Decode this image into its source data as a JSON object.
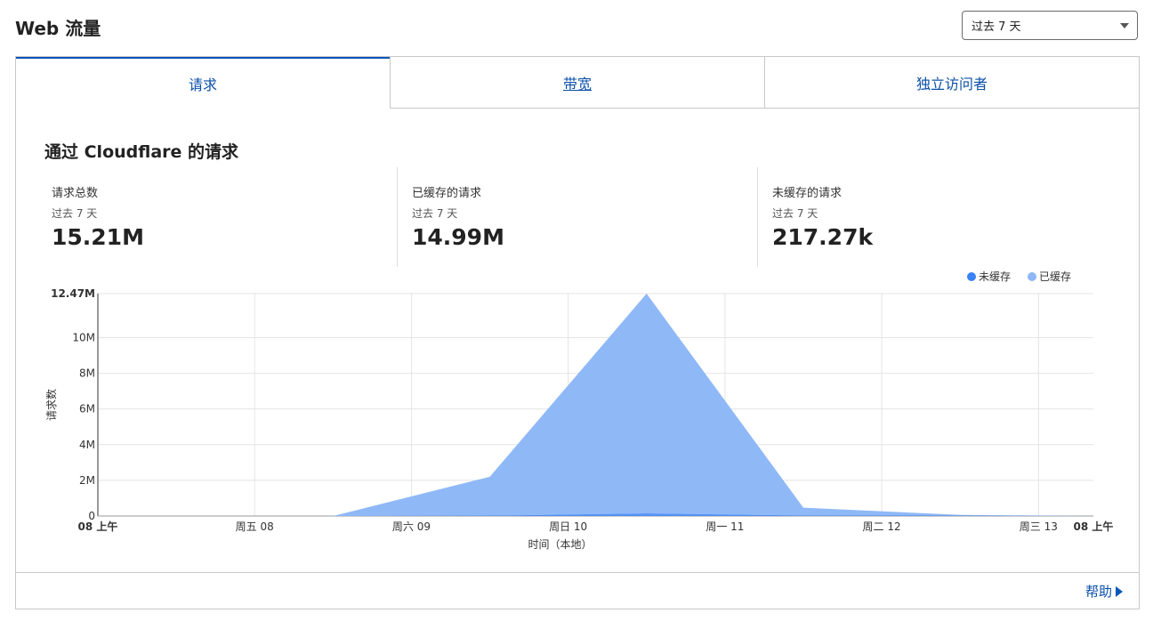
{
  "header": {
    "title": "Web 流量",
    "range_value": "过去 7 天"
  },
  "tabs": [
    {
      "label": "请求"
    },
    {
      "label": "带宽"
    },
    {
      "label": "独立访问者"
    }
  ],
  "section": {
    "title": "通过 Cloudflare 的请求"
  },
  "stats": [
    {
      "label": "请求总数",
      "period": "过去 7 天",
      "value": "15.21M"
    },
    {
      "label": "已缓存的请求",
      "period": "过去 7 天",
      "value": "14.99M"
    },
    {
      "label": "未缓存的请求",
      "period": "过去 7 天",
      "value": "217.27k"
    }
  ],
  "help": {
    "label": "帮助"
  },
  "colors": {
    "uncached": "#3b82f6",
    "cached": "#8fb8f7",
    "accent": "#0b4fa8"
  },
  "chart_data": {
    "type": "area",
    "stacked": true,
    "ylabel": "请求数",
    "xlabel": "时间（本地）",
    "ylim": [
      0,
      12470000
    ],
    "y_ticks": [
      {
        "value": 0,
        "label": "0"
      },
      {
        "value": 2000000,
        "label": "2M"
      },
      {
        "value": 4000000,
        "label": "4M"
      },
      {
        "value": 6000000,
        "label": "6M"
      },
      {
        "value": 8000000,
        "label": "8M"
      },
      {
        "value": 10000000,
        "label": "10M"
      },
      {
        "value": 12470000,
        "label": "12.47M"
      }
    ],
    "x_ticks": [
      {
        "x": 0,
        "label": "08 上午",
        "bold": true
      },
      {
        "x": 1,
        "label": "周五 08"
      },
      {
        "x": 2,
        "label": "周六 09"
      },
      {
        "x": 3,
        "label": "周日 10"
      },
      {
        "x": 4,
        "label": "周一 11"
      },
      {
        "x": 5,
        "label": "周二 12"
      },
      {
        "x": 6,
        "label": "周三 13"
      },
      {
        "x": 6.35,
        "label": "08 上午",
        "bold": true
      }
    ],
    "xlim": [
      0,
      6.35
    ],
    "legend": "top-right",
    "grid": true,
    "series": [
      {
        "name": "未缓存",
        "x": [
          0,
          1.5,
          2.5,
          3.5,
          4.5,
          5.5,
          6.35
        ],
        "values": [
          0,
          0,
          20000,
          150000,
          30000,
          20000,
          0
        ]
      },
      {
        "name": "已缓存",
        "x": [
          0,
          1.5,
          2.5,
          3.5,
          4.5,
          5.5,
          6.35
        ],
        "values": [
          0,
          0,
          2180000,
          12320000,
          440000,
          40000,
          0
        ]
      }
    ]
  }
}
